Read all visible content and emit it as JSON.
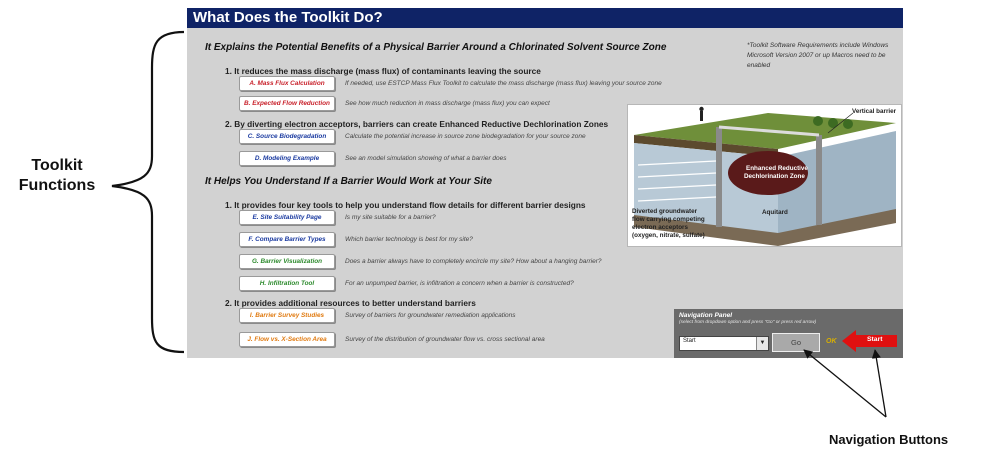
{
  "annotations": {
    "toolkit_functions": "Toolkit Functions",
    "navigation_buttons": "Navigation Buttons"
  },
  "panel": {
    "title": "What Does the Toolkit Do?",
    "requirements_note": "*Toolkit Software Requirements include Windows Microsoft Version 2007 or up Macros need to be enabled",
    "section1": {
      "heading": "It Explains the Potential Benefits of a Physical Barrier Around a Chlorinated Solvent Source Zone",
      "item1": "1.  It reduces the mass discharge (mass flux) of contaminants leaving the source",
      "item2": "2.  By diverting electron acceptors, barriers can create Enhanced Reductive Dechlorination Zones",
      "buttons": [
        {
          "label": "A. Mass Flux Calculation",
          "desc": "If needed, use ESTCP Mass Flux Toolkit to calculate the mass discharge (mass flux) leaving your source zone"
        },
        {
          "label": "B. Expected Flow Reduction",
          "desc": "See how much reduction in mass discharge (mass flux) you can expect"
        },
        {
          "label": "C. Source Biodegradation",
          "desc": "Calculate the potential increase in source zone biodegradation for your source zone"
        },
        {
          "label": "D. Modeling Example",
          "desc": "See an model simulation showing  of what a barrier does"
        }
      ]
    },
    "section2": {
      "heading": "It Helps You Understand If a Barrier Would Work at Your Site",
      "item1": "1.  It provides four key tools to help you understand flow details for different barrier designs",
      "item2": "2.  It provides additional resources to better understand barriers",
      "buttons": [
        {
          "label": "E. Site Suitability Page",
          "desc": "Is my site suitable for a barrier?"
        },
        {
          "label": "F. Compare Barrier Types",
          "desc": "Which barrier technology is best for my site?"
        },
        {
          "label": "G. Barrier Visualization",
          "desc": "Does a barrier always have to completely encircle my site?  How about a hanging barrier?"
        },
        {
          "label": "H. Infiltration Tool",
          "desc": "For an unpumped barrier, is infiltration a concern when a barrier is constructed?"
        },
        {
          "label": "I. Barrier Survey Studies",
          "desc": "Survey of barriers for groundwater remediation applications"
        },
        {
          "label": "J. Flow vs. X-Section Area",
          "desc": "Survey of the distribution of groundwater flow vs. cross sectional area"
        }
      ]
    },
    "illustration": {
      "vertical_barrier": "Vertical barrier",
      "erd_zone_line1": "Enhanced Reductive",
      "erd_zone_line2": "Dechlorination Zone",
      "aquitard": "Aquitard",
      "diverted_line1": "Diverted groundwater",
      "diverted_line2": "flow carrying competing",
      "diverted_line3": "electron acceptors",
      "diverted_line4": "(oxygen, nitrate, sulfate)"
    },
    "navigation": {
      "title": "Navigation Panel",
      "hint": "(select from dropdown option and press \"Go\" or press red arrow)",
      "select_value": "Start",
      "go_label": "Go",
      "ok_label": "OK",
      "start_label": "Start"
    }
  },
  "colors": {
    "title_bar": "#0f2366",
    "panel_bg": "#d2d2d2",
    "button_red": "#c8202a",
    "button_blue": "#1a3aa0",
    "button_green": "#2d8a2d",
    "button_orange": "#e07a10",
    "start_arrow": "#e01010"
  }
}
